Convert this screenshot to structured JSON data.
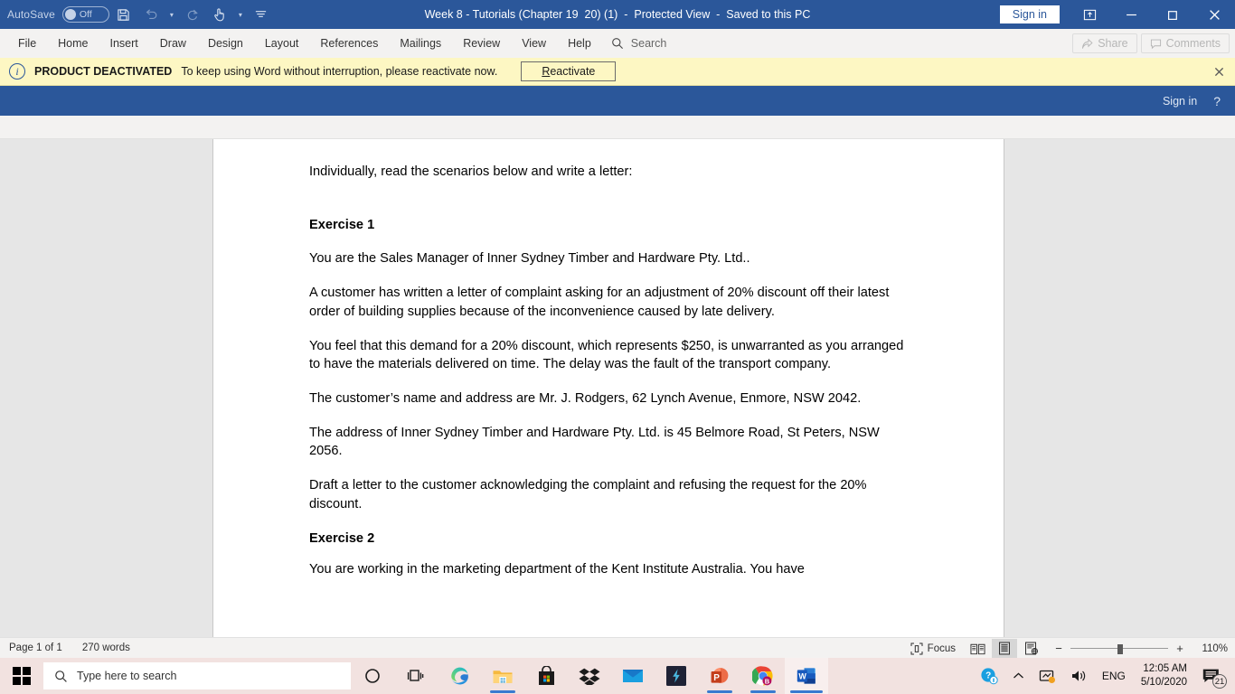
{
  "titlebar": {
    "autosave_label": "AutoSave",
    "autosave_state": "Off",
    "save_icon": "save-icon",
    "undo_icon": "undo-icon",
    "redo_icon": "redo-icon",
    "touch_icon": "touch-mode-icon",
    "customize_icon": "customize-quick-access-icon",
    "title": "Week 8 - Tutorials (Chapter 19  20) (1)  -  Protected View  -  Saved to this PC",
    "signin_label": "Sign in",
    "ribbon_display_icon": "ribbon-display-options-icon",
    "minimize_icon": "minimize-icon",
    "maximize_icon": "maximize-icon",
    "close_icon": "close-icon"
  },
  "ribbon": {
    "tabs": [
      {
        "label": "File"
      },
      {
        "label": "Home"
      },
      {
        "label": "Insert"
      },
      {
        "label": "Draw"
      },
      {
        "label": "Design"
      },
      {
        "label": "Layout"
      },
      {
        "label": "References"
      },
      {
        "label": "Mailings"
      },
      {
        "label": "Review"
      },
      {
        "label": "View"
      },
      {
        "label": "Help"
      }
    ],
    "search_placeholder": "Search",
    "share_label": "Share",
    "comments_label": "Comments"
  },
  "warning": {
    "icon": "info-icon",
    "title": "PRODUCT DEACTIVATED",
    "message": "To keep using Word without interruption, please reactivate now.",
    "button_prefix": "R",
    "button_rest": "eactivate",
    "close_icon": "close-icon"
  },
  "bluestrip": {
    "signin_label": "Sign in",
    "help_label": "?"
  },
  "document": {
    "paragraphs": [
      {
        "text": "Individually, read the scenarios below and write a letter:",
        "style": "spacer-after"
      },
      {
        "text": "Exercise 1",
        "style": "bold"
      },
      {
        "text": "You are the Sales Manager of Inner Sydney Timber and Hardware Pty. Ltd..",
        "style": "normal"
      },
      {
        "text": "A customer has written a letter of complaint asking for an adjustment of 20% discount off their latest order of building supplies because of the inconvenience caused by late delivery.",
        "style": "normal"
      },
      {
        "text": "You feel that this demand for a 20% discount, which represents $250, is unwarranted as you arranged to have the materials delivered on time.  The delay was the fault of the transport company.",
        "style": "normal"
      },
      {
        "text": "The customer’s name and address are Mr. J. Rodgers, 62 Lynch Avenue, Enmore, NSW 2042.",
        "style": "normal"
      },
      {
        "text": "The address of Inner Sydney Timber and Hardware Pty. Ltd. is 45 Belmore Road, St Peters, NSW 2056.",
        "style": "normal"
      },
      {
        "text": "Draft a letter to the customer acknowledging the complaint and refusing the request for the 20% discount.",
        "style": "normal"
      },
      {
        "text": "Exercise 2",
        "style": "bold tight"
      },
      {
        "text": "You are working in the marketing department of the Kent Institute Australia.  You have",
        "style": "normal"
      }
    ]
  },
  "statusbar": {
    "page_label": "Page 1 of 1",
    "word_count": "270 words",
    "focus_label": "Focus",
    "read_mode_icon": "read-mode-icon",
    "print_layout_icon": "print-layout-icon",
    "web_layout_icon": "web-layout-icon",
    "zoom_out": "−",
    "zoom_in": "+",
    "zoom_level": "110%"
  },
  "taskbar": {
    "start_icon": "windows-start-icon",
    "search_placeholder": "Type here to search",
    "search_icon": "search-icon",
    "items": [
      {
        "name": "cortana-icon"
      },
      {
        "name": "task-view-icon"
      },
      {
        "name": "microsoft-edge-icon"
      },
      {
        "name": "file-explorer-icon"
      },
      {
        "name": "microsoft-store-icon"
      },
      {
        "name": "dropbox-icon"
      },
      {
        "name": "mail-icon"
      },
      {
        "name": "lightning-app-icon"
      },
      {
        "name": "powerpoint-icon"
      },
      {
        "name": "google-chrome-icon"
      },
      {
        "name": "microsoft-word-icon"
      }
    ],
    "tray": {
      "help_icon": "help-support-icon",
      "show_hidden_icon": "show-hidden-icons-chevron",
      "network_icon": "network-icon",
      "volume_icon": "volume-icon",
      "language": "ENG",
      "time": "12:05 AM",
      "date": "5/10/2020",
      "notifications_icon": "notifications-icon",
      "notifications_count": "21"
    }
  },
  "colors": {
    "word_blue": "#2b579a",
    "warning_yellow": "#fdf7c3",
    "taskbar": "#f2e2e0",
    "ribbon_grey": "#f3f2f1",
    "workspace_grey": "#e6e6e6"
  }
}
